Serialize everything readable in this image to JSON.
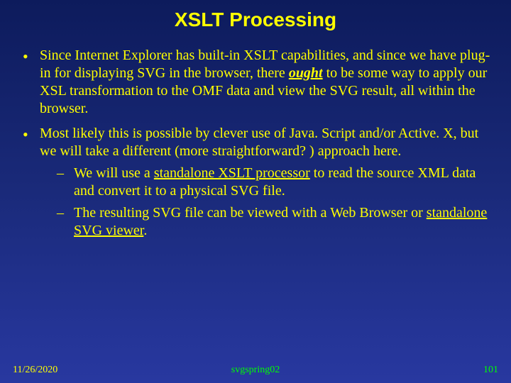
{
  "title": "XSLT Processing",
  "bullets": [
    {
      "pre": "Since Internet Explorer has built-in XSLT capabilities, and since we have plug-in for displaying SVG in the browser, there ",
      "ought": "ought",
      "post": " to be some way to apply our XSL transformation to the OMF data and view the SVG result, all within the browser."
    },
    {
      "text": "Most likely this is possible by clever use of Java. Script and/or Active. X, but we will take a different (more straightforward? ) approach here.",
      "sub": [
        {
          "pre": "We will use a ",
          "u": "standalone XSLT processor",
          "post": " to read the source XML data and convert it to a physical SVG file."
        },
        {
          "pre": "The resulting SVG file can be viewed with a Web Browser or ",
          "u": "standalone SVG viewer",
          "post": "."
        }
      ]
    }
  ],
  "footer": {
    "date": "11/26/2020",
    "source": "svgspring02",
    "page": "101"
  }
}
